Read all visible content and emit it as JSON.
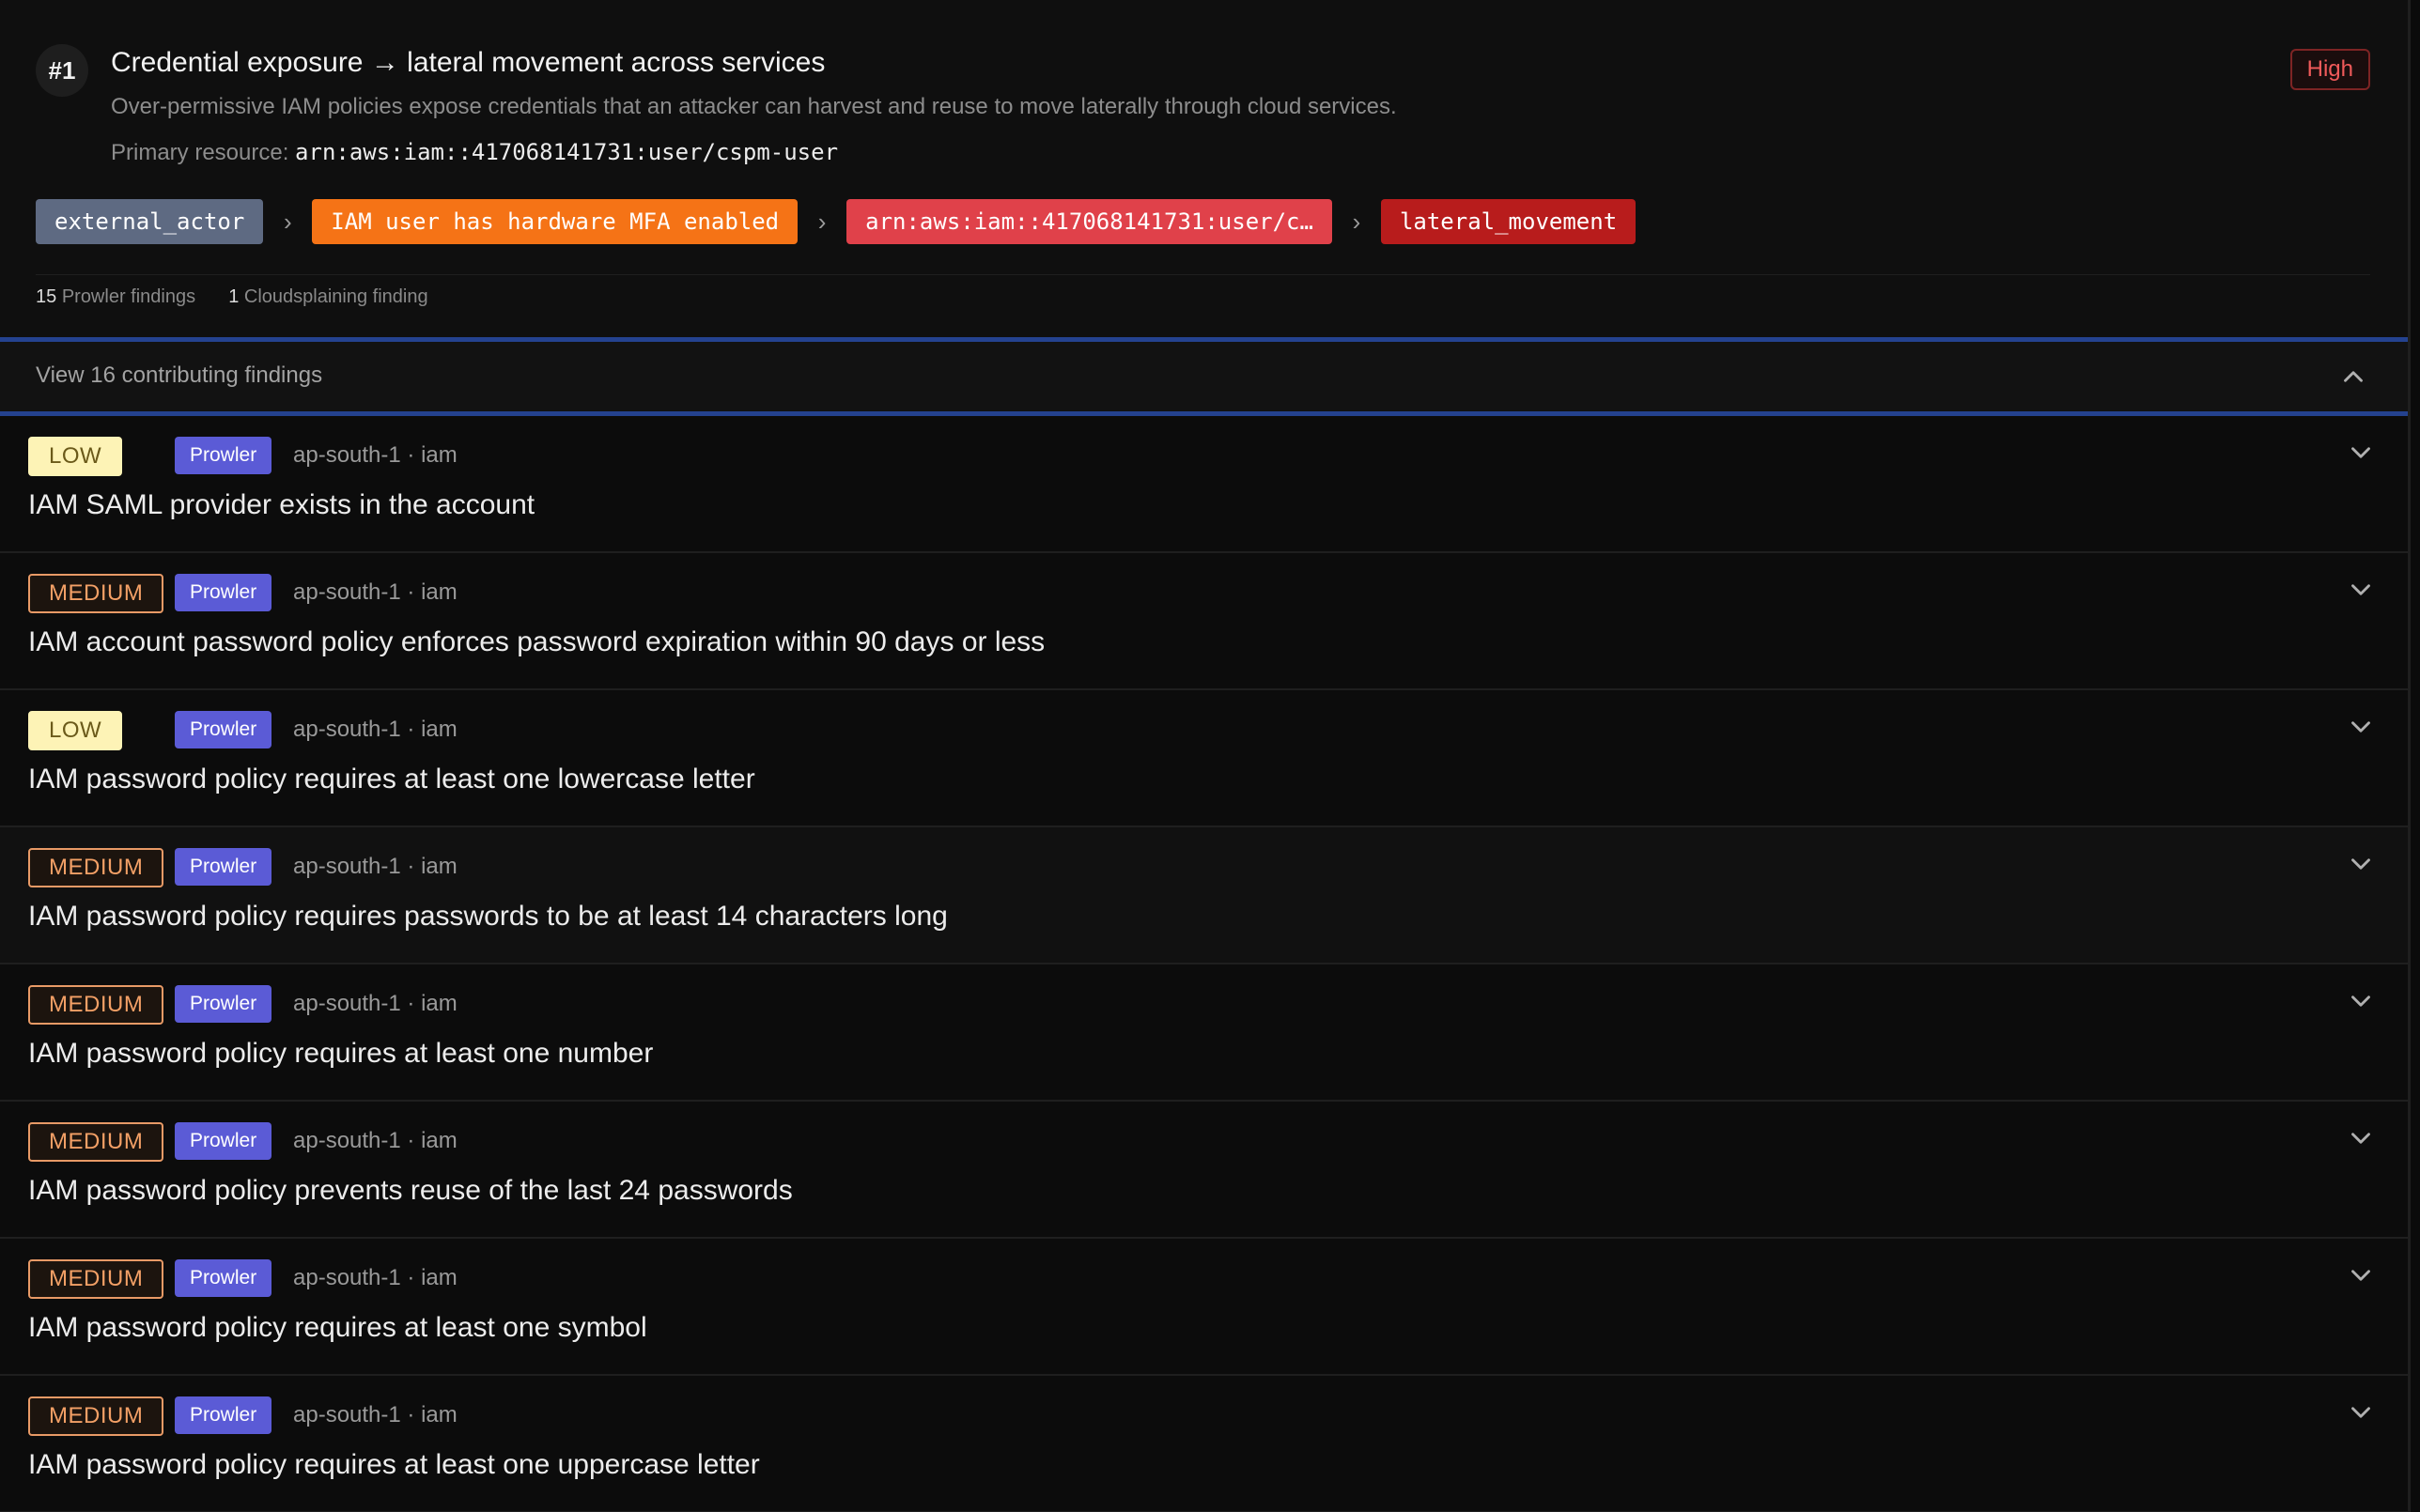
{
  "header": {
    "rank": "#1",
    "title": "Credential exposure → lateral movement across services",
    "description": "Over-permissive IAM policies expose credentials that an attacker can harvest and reuse to move laterally through cloud services.",
    "primary_label": "Primary resource:",
    "primary_value": "arn:aws:iam::417068141731:user/cspm-user",
    "severity": "High",
    "severity_color": "#f05a5a"
  },
  "path": {
    "nodes": [
      {
        "label": "external_actor",
        "color": "#5e6a82"
      },
      {
        "label": "IAM user has hardware MFA enabled",
        "color": "#f57316"
      },
      {
        "label": "arn:aws:iam::417068141731:user/c…",
        "color": "#e0414a"
      },
      {
        "label": "lateral_movement",
        "color": "#b81c1c"
      }
    ]
  },
  "counts": {
    "prowler_count": "15",
    "prowler_label": "Prowler findings",
    "cloud_count": "1",
    "cloud_label": "Cloudsplaining finding"
  },
  "toggle": {
    "label": "View 16 contributing findings",
    "accent": "#24428f"
  },
  "findings": [
    {
      "severity": "LOW",
      "source": "Prowler",
      "meta": "ap-south-1 · iam",
      "title": "IAM SAML provider exists in the account"
    },
    {
      "severity": "MEDIUM",
      "source": "Prowler",
      "meta": "ap-south-1 · iam",
      "title": "IAM account password policy enforces password expiration within 90 days or less"
    },
    {
      "severity": "LOW",
      "source": "Prowler",
      "meta": "ap-south-1 · iam",
      "title": "IAM password policy requires at least one lowercase letter"
    },
    {
      "severity": "MEDIUM",
      "source": "Prowler",
      "meta": "ap-south-1 · iam",
      "title": "IAM password policy requires passwords to be at least 14 characters long"
    },
    {
      "severity": "MEDIUM",
      "source": "Prowler",
      "meta": "ap-south-1 · iam",
      "title": "IAM password policy requires at least one number"
    },
    {
      "severity": "MEDIUM",
      "source": "Prowler",
      "meta": "ap-south-1 · iam",
      "title": "IAM password policy prevents reuse of the last 24 passwords"
    },
    {
      "severity": "MEDIUM",
      "source": "Prowler",
      "meta": "ap-south-1 · iam",
      "title": "IAM password policy requires at least one symbol"
    },
    {
      "severity": "MEDIUM",
      "source": "Prowler",
      "meta": "ap-south-1 · iam",
      "title": "IAM password policy requires at least one uppercase letter"
    }
  ],
  "icons": {
    "toggle": "chevron-up-icon",
    "finding_expand": "chevron-down-icon",
    "path_separator": "chevron-right-icon"
  }
}
